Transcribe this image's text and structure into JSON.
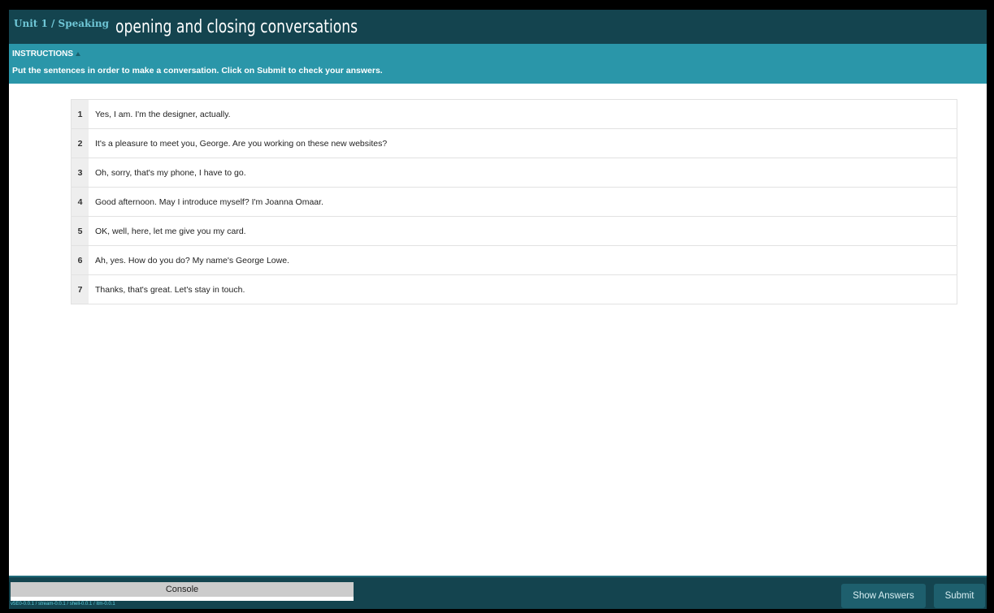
{
  "header": {
    "breadcrumb": "Unit 1 / Speaking",
    "title": "opening and closing conversations"
  },
  "instructions": {
    "toggle_label": "INSTRUCTIONS",
    "text": "Put the sentences in order to make a conversation. Click on Submit to check your answers."
  },
  "sentences": [
    {
      "num": "1",
      "text": "Yes, I am. I'm the designer, actually."
    },
    {
      "num": "2",
      "text": "It's a pleasure to meet you, George. Are you working on these new websites?"
    },
    {
      "num": "3",
      "text": "Oh, sorry, that's my phone, I have to go."
    },
    {
      "num": "4",
      "text": "Good afternoon. May I introduce myself? I'm Joanna Omaar."
    },
    {
      "num": "5",
      "text": "OK, well, here, let me give you my card."
    },
    {
      "num": "6",
      "text": "Ah, yes. How do you do? My name's George Lowe."
    },
    {
      "num": "7",
      "text": "Thanks, that's great. Let's stay in touch."
    }
  ],
  "footer": {
    "console_label": "Console",
    "version_text": "v5E0-0.0.1 / stream-0.0.1 / shell-0.0.1 / itm-0.0.1",
    "show_answers_label": "Show Answers",
    "submit_label": "Submit"
  },
  "colors": {
    "header_bg": "#14444f",
    "instructions_bg": "#2a96a9",
    "breadcrumb": "#6fc6d6",
    "button_bg": "#1e5f6d"
  }
}
